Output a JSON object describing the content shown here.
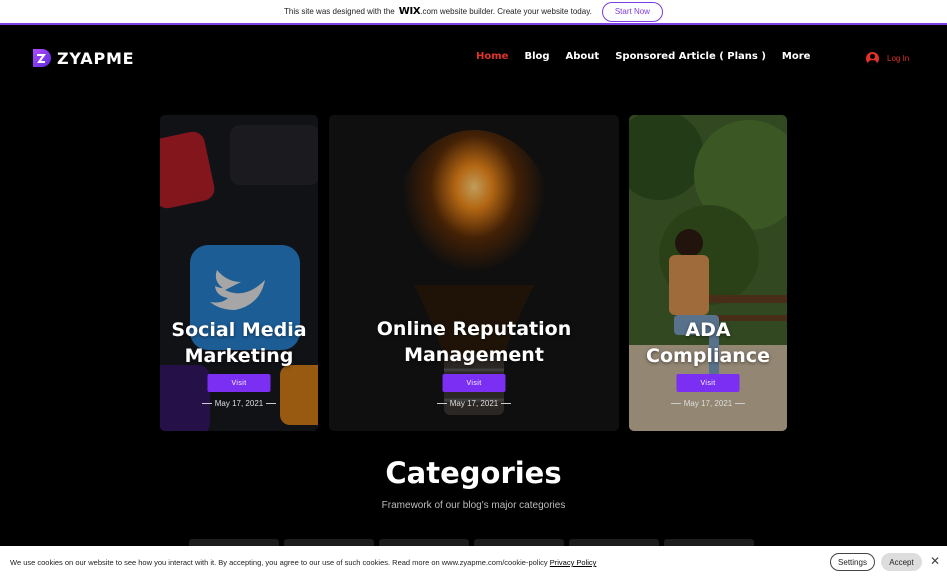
{
  "wix_banner": {
    "text_before": "This site was designed with the",
    "wix_logo": "WIX",
    "text_after": ".com website builder. Create your website today.",
    "start_button": "Start Now",
    "accent_color": "#7b3fe4"
  },
  "header": {
    "logo_text": "ZYAPME",
    "nav": [
      {
        "label": "Home",
        "active": true
      },
      {
        "label": "Blog",
        "active": false
      },
      {
        "label": "About",
        "active": false
      },
      {
        "label": "Sponsored Article ( Plans )",
        "active": false
      },
      {
        "label": "More",
        "active": false
      }
    ],
    "login_label": "Log In",
    "accent_color": "#e0322b"
  },
  "cards": [
    {
      "title_line1": "Social Media",
      "title_line2": "Marketing",
      "visit_label": "Visit",
      "date": "May 17, 2021",
      "image": "social-media-apps-photo"
    },
    {
      "title_line1": "Online Reputation",
      "title_line2": "Management",
      "visit_label": "Visit",
      "date": "May 17, 2021",
      "image": "lightbulb-photo"
    },
    {
      "title_line1": "ADA",
      "title_line2": "Compliance",
      "visit_label": "Visit",
      "date": "May 17, 2021",
      "image": "woman-reading-bench-photo"
    }
  ],
  "categories": {
    "title": "Categories",
    "subtitle": "Framework of our blog's major categories"
  },
  "cookie_banner": {
    "message": "We use cookies on our website to see how you interact with it. By accepting, you agree to our use of such cookies. Read more on www.zyapme.com/cookie-policy",
    "policy_link": "Privacy Policy",
    "settings_label": "Settings",
    "accept_label": "Accept"
  },
  "colors": {
    "visit_button": "#7b2ff2",
    "background": "#000000"
  }
}
